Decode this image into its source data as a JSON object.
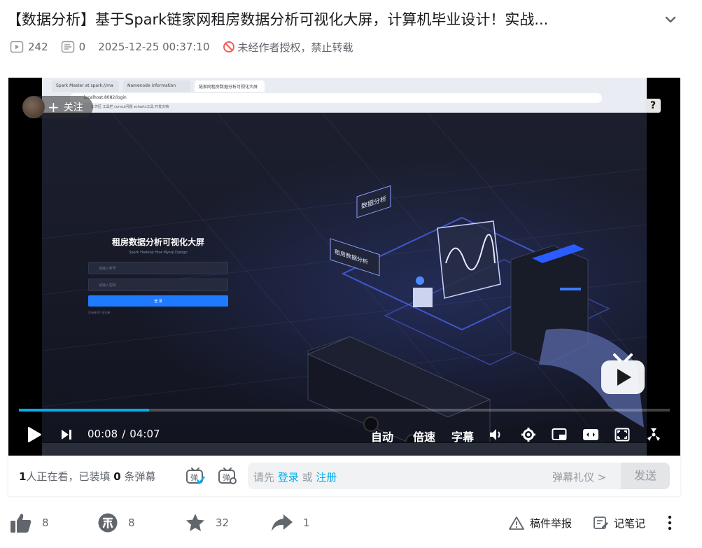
{
  "video": {
    "title": "【数据分析】基于Spark链家网租房数据分析可视化大屏，计算机毕业设计！实战...",
    "play_count": "242",
    "danmaku_count": "0",
    "publish_time": "2025-12-25 00:37:10",
    "copyright_notice": "未经作者授权，禁止转载"
  },
  "player": {
    "follow_label": "关注",
    "follow_plus": "+",
    "help_label": "?",
    "current_time": "00:08",
    "time_separator": "/",
    "duration": "04:07",
    "progress_fraction": 0.2,
    "buffer_fraction": 0.2,
    "auto_label": "自动",
    "speed_label": "倍速",
    "subtitle_label": "字幕",
    "accent_color": "#00aeec"
  },
  "screen_content": {
    "tabs": [
      "Spark Master at spark://ma",
      "Namenode information",
      "链家网租房数据分析可视化大屏"
    ],
    "url": "localhost:8082/login",
    "bookmarks": "工作区  工具栏  consul问题  echarts工具  开发文档",
    "login_title": "租房数据分析可视化大屏",
    "login_subtitle": "Spark Hadoop Hive Mysql Django",
    "username_placeholder": "请输入账号",
    "password_placeholder": "请输入密码",
    "login_button": "登 录",
    "login_links": "没有账号? 去注册",
    "sign_text_1": "数据分析",
    "sign_text_2": "租房数据分析"
  },
  "danmaku": {
    "viewers_count": "1",
    "viewers_text": "人正在看，已装填",
    "danmaku_filled": "0",
    "danmaku_suffix": "条弹幕",
    "placeholder_prefix": "请先",
    "login_link": "登录",
    "or_text": "或",
    "register_link": "注册",
    "etiquette_label": "弹幕礼仪",
    "etiquette_chevron": ">",
    "send_label": "发送"
  },
  "actions": {
    "like_count": "8",
    "coin_count": "8",
    "favorite_count": "32",
    "share_count": "1",
    "report_label": "稿件举报",
    "notes_label": "记笔记"
  }
}
